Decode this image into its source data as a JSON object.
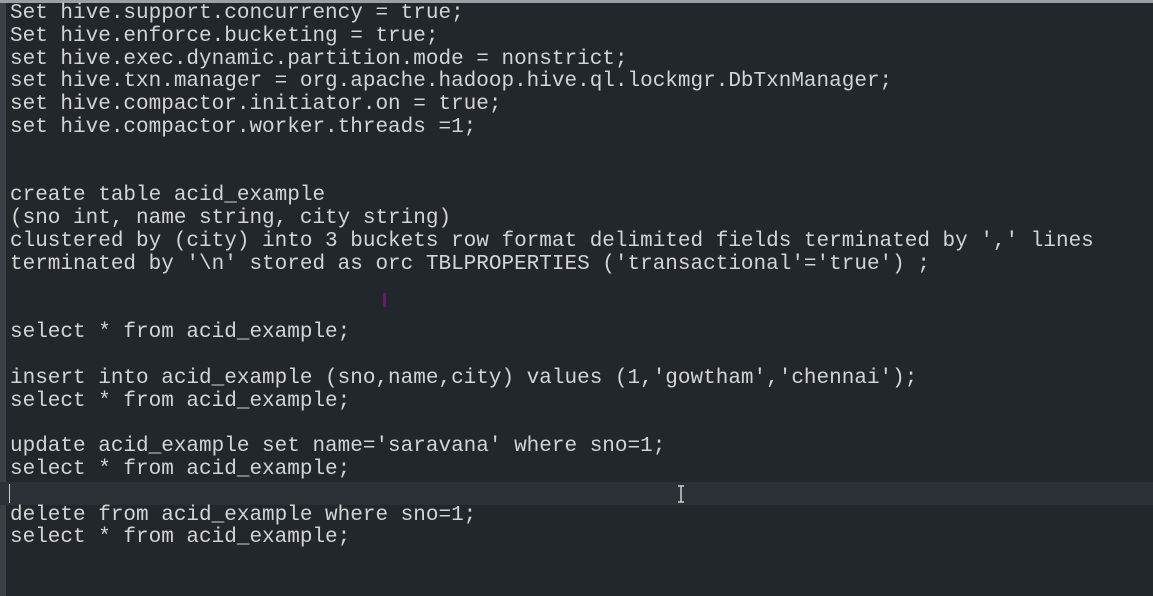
{
  "editor": {
    "lines": [
      "Set hive.support.concurrency = true;",
      "Set hive.enforce.bucketing = true;",
      "set hive.exec.dynamic.partition.mode = nonstrict;",
      "set hive.txn.manager = org.apache.hadoop.hive.ql.lockmgr.DbTxnManager;",
      "set hive.compactor.initiator.on = true;",
      "set hive.compactor.worker.threads =1;",
      "",
      "",
      "create table acid_example",
      "(sno int, name string, city string)",
      "clustered by (city) into 3 buckets row format delimited fields terminated by ',' lines",
      "terminated by '\\n' stored as orc TBLPROPERTIES ('transactional'='true') ;",
      "",
      "",
      "select * from acid_example;",
      "",
      "insert into acid_example (sno,name,city) values (1,'gowtham','chennai');",
      "select * from acid_example;",
      "",
      "update acid_example set name='saravana' where sno=1;",
      "select * from acid_example;",
      "",
      "delete from acid_example where sno=1;",
      "select * from acid_example;"
    ],
    "current_line_index": 21
  }
}
